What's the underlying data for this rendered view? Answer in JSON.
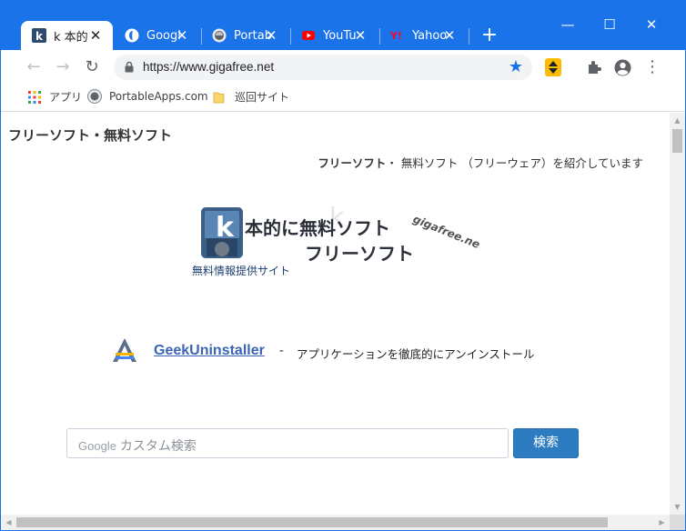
{
  "tabs": [
    {
      "title": "k 本的",
      "favicon": "k-icon",
      "active": true
    },
    {
      "title": "Googl",
      "favicon": "google-icon",
      "active": false
    },
    {
      "title": "Portab",
      "favicon": "portableapps-icon",
      "active": false
    },
    {
      "title": "YouTu",
      "favicon": "youtube-icon",
      "active": false
    },
    {
      "title": "Yahoo",
      "favicon": "yahoo-icon",
      "active": false
    }
  ],
  "new_tab_label": "+",
  "window_controls": {
    "minimize": "—",
    "maximize": "☐",
    "close": "✕"
  },
  "toolbar": {
    "back": "←",
    "forward": "→",
    "reload": "↻",
    "url": "https://www.gigafree.net",
    "menu": "⋮"
  },
  "bookmarks": [
    {
      "label": "アプリ",
      "icon": "apps-grid-icon"
    },
    {
      "label": "PortableApps.com",
      "icon": "portableapps-icon"
    },
    {
      "label": "巡回サイト",
      "icon": "folder-icon"
    }
  ],
  "page": {
    "title": "フリーソフト・無料ソフト",
    "tagline_bold": "フリーソフト",
    "tagline_rest": "・ 無料ソフト （フリーウェア）を紹介しています",
    "logo_main": "本的に無料ソフト",
    "logo_sub2": "フリーソフト",
    "logo_domain": "gigafree.net",
    "logo_caption": "無料情報提供サイト",
    "software_link": "GeekUninstaller",
    "software_dash": "-",
    "software_desc": "アプリケーションを徹底的にアンインストール",
    "search_google": "Google",
    "search_placeholder": "カスタム検索",
    "search_button": "検索"
  },
  "colors": {
    "chrome_blue": "#1a73e8",
    "link": "#3c64b4",
    "search_button": "#2d7cc2"
  }
}
